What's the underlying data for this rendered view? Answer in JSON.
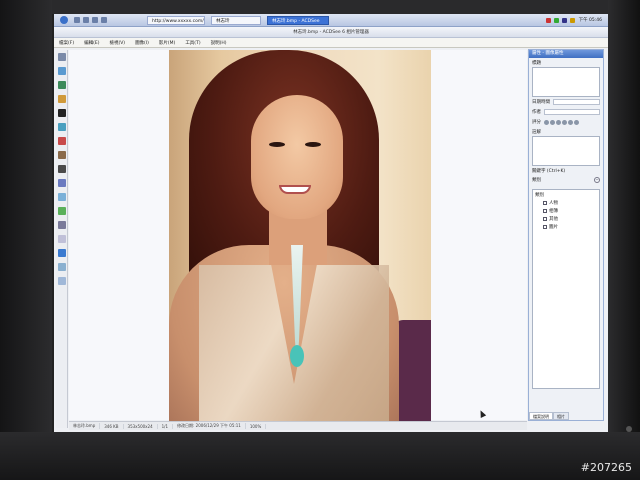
{
  "taskbar": {
    "tasks": [
      "http://www.xxxxx.com/...",
      "林志玲",
      "林志玲.bmp - ACDSee"
    ],
    "clock": "下午 05:46"
  },
  "window": {
    "title": "林志玲.bmp - ACDSee 6 相片管理器"
  },
  "menus": [
    "檔案(F)",
    "編輯(E)",
    "檢視(V)",
    "圖像(I)",
    "影片(M)",
    "工具(T)",
    "說明(H)"
  ],
  "status": [
    "林志玲.bmp",
    "346 KB",
    "353x500x24",
    "1/1",
    "修改日期: 2006/12/29 下午 05:11",
    "100%"
  ],
  "panel": {
    "title": "屬性 - 圖像屬性",
    "caption_label": "標題",
    "date_label": "日期時間",
    "author_label": "作者",
    "rating_label": "評分",
    "notes_label": "註解",
    "keywords_label": "關鍵字 (Ctrl+K)",
    "categories_label": "類別",
    "tree_root": "類別",
    "tree_items": [
      "人物",
      "相簿",
      "其他",
      "圖片"
    ],
    "tabs": [
      "檔案說明",
      "相片"
    ]
  },
  "watermark": "#207265"
}
